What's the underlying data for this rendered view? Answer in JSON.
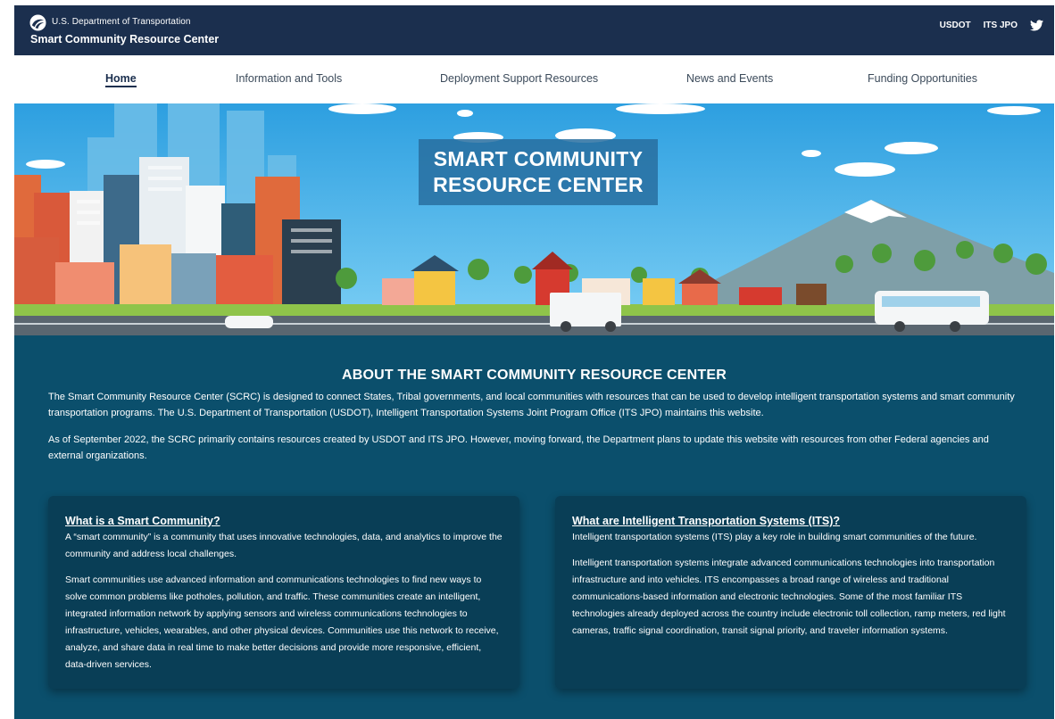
{
  "header": {
    "department": "U.S. Department of Transportation",
    "site_name": "Smart Community Resource Center",
    "links": [
      "USDOT",
      "ITS JPO"
    ],
    "social_icon": "twitter-icon"
  },
  "nav": {
    "items": [
      {
        "label": "Home",
        "active": true
      },
      {
        "label": "Information and Tools",
        "active": false
      },
      {
        "label": "Deployment Support Resources",
        "active": false
      },
      {
        "label": "News and Events",
        "active": false
      },
      {
        "label": "Funding Opportunities",
        "active": false
      }
    ]
  },
  "hero": {
    "title_line1": "SMART COMMUNITY",
    "title_line2": "RESOURCE CENTER"
  },
  "about": {
    "heading": "ABOUT THE SMART COMMUNITY RESOURCE CENTER",
    "paragraph1": "The Smart Community Resource Center (SCRC) is designed to connect States, Tribal governments, and local communities with resources that can be used to develop intelligent transportation systems and smart community transportation programs. The U.S. Department of Transportation (USDOT), Intelligent Transportation Systems Joint Program Office (ITS JPO) maintains this website.",
    "paragraph2": "As of September 2022, the SCRC primarily contains resources created by USDOT and ITS JPO. However, moving forward, the Department plans to update this website with resources from other Federal agencies and external organizations."
  },
  "cards": [
    {
      "title": "What is a Smart Community?",
      "paragraphs": [
        "A “smart community” is a community that uses innovative technologies, data, and analytics to improve the community and address local challenges.",
        "Smart communities use advanced information and communications technologies to find new ways to solve common problems like potholes, pollution, and traffic. These communities create an intelligent, integrated information network by applying sensors and wireless communications technologies to infrastructure, vehicles, wearables, and other physical devices. Communities use this network to receive, analyze, and share data in real time to make better decisions and provide more responsive, efficient, data-driven services."
      ]
    },
    {
      "title": "What are Intelligent Transportation Systems (ITS)?",
      "paragraphs": [
        "Intelligent transportation systems (ITS) play a key role in building smart communities of the future.",
        "Intelligent transportation systems integrate advanced communications technologies into transportation infrastructure and into vehicles. ITS encompasses a broad range of wireless and traditional communications-based information and electronic technologies. Some of the most familiar ITS technologies already deployed across the country include electronic toll collection, ramp meters, red light cameras, traffic signal coordination, transit signal priority, and traveler information systems."
      ]
    }
  ],
  "colors": {
    "header_bg": "#1b2f4e",
    "about_bg": "#0b4f6c",
    "card_bg": "#093e56",
    "sky": "#38a9e6"
  }
}
